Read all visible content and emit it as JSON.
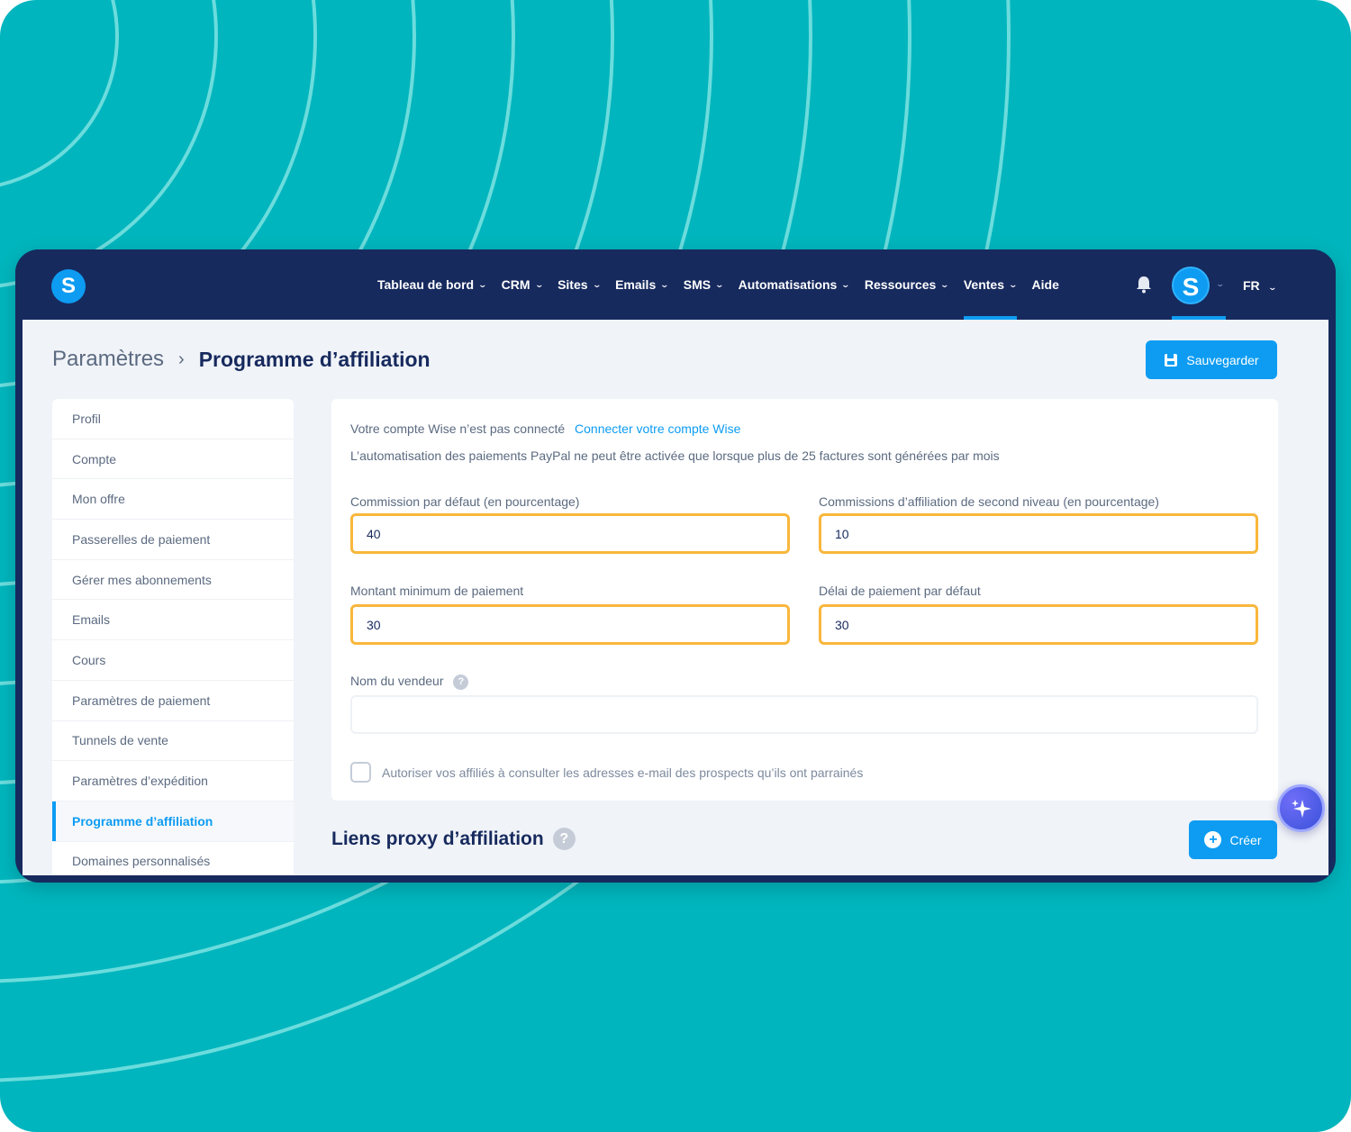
{
  "nav": {
    "items": [
      {
        "label": "Tableau de bord",
        "has_menu": true
      },
      {
        "label": "CRM",
        "has_menu": true
      },
      {
        "label": "Sites",
        "has_menu": true
      },
      {
        "label": "Emails",
        "has_menu": true
      },
      {
        "label": "SMS",
        "has_menu": true
      },
      {
        "label": "Automatisations",
        "has_menu": true
      },
      {
        "label": "Ressources",
        "has_menu": true
      },
      {
        "label": "Ventes",
        "has_menu": true,
        "active": true
      },
      {
        "label": "Aide",
        "has_menu": false
      }
    ],
    "logo_letter": "S",
    "avatar_letter": "S",
    "language": "FR"
  },
  "breadcrumb": {
    "parent": "Paramètres",
    "current": "Programme d’affiliation"
  },
  "save_label": "Sauvegarder",
  "sidebar": {
    "items": [
      {
        "label": "Profil"
      },
      {
        "label": "Compte"
      },
      {
        "label": "Mon offre"
      },
      {
        "label": "Passerelles de paiement"
      },
      {
        "label": "Gérer mes abonnements"
      },
      {
        "label": "Emails"
      },
      {
        "label": "Cours"
      },
      {
        "label": "Paramètres de paiement"
      },
      {
        "label": "Tunnels de vente"
      },
      {
        "label": "Paramètres d’expédition"
      },
      {
        "label": "Programme d’affiliation",
        "active": true
      },
      {
        "label": "Domaines personnalisés"
      }
    ]
  },
  "panel": {
    "wise_status": "Votre compte Wise n’est pas connecté",
    "wise_link": "Connecter votre compte Wise",
    "paypal_note": "L’automatisation des paiements PayPal ne peut être activée que lorsque plus de 25 factures sont générées par mois",
    "fields": {
      "commission": {
        "label": "Commission par défaut (en pourcentage)",
        "value": "40"
      },
      "second_level": {
        "label": "Commissions d’affiliation de second niveau (en pourcentage)",
        "value": "10"
      },
      "min_payment": {
        "label": "Montant minimum de paiement",
        "value": "30"
      },
      "payment_delay": {
        "label": "Délai de paiement par défaut",
        "value": "30"
      },
      "seller_name": {
        "label": "Nom du vendeur",
        "value": ""
      }
    },
    "allow_emails_label": "Autoriser vos affiliés à consulter les adresses e-mail des prospects qu’ils ont parrainés",
    "allow_emails_checked": false
  },
  "proxy_section": {
    "title": "Liens proxy d’affiliation",
    "create_label": "Créer"
  },
  "help_glyph": "?",
  "colors": {
    "background": "#00b5bd",
    "navbar": "#172a5e",
    "accent": "#0d9cf2",
    "highlight_border": "#f8b73c"
  }
}
